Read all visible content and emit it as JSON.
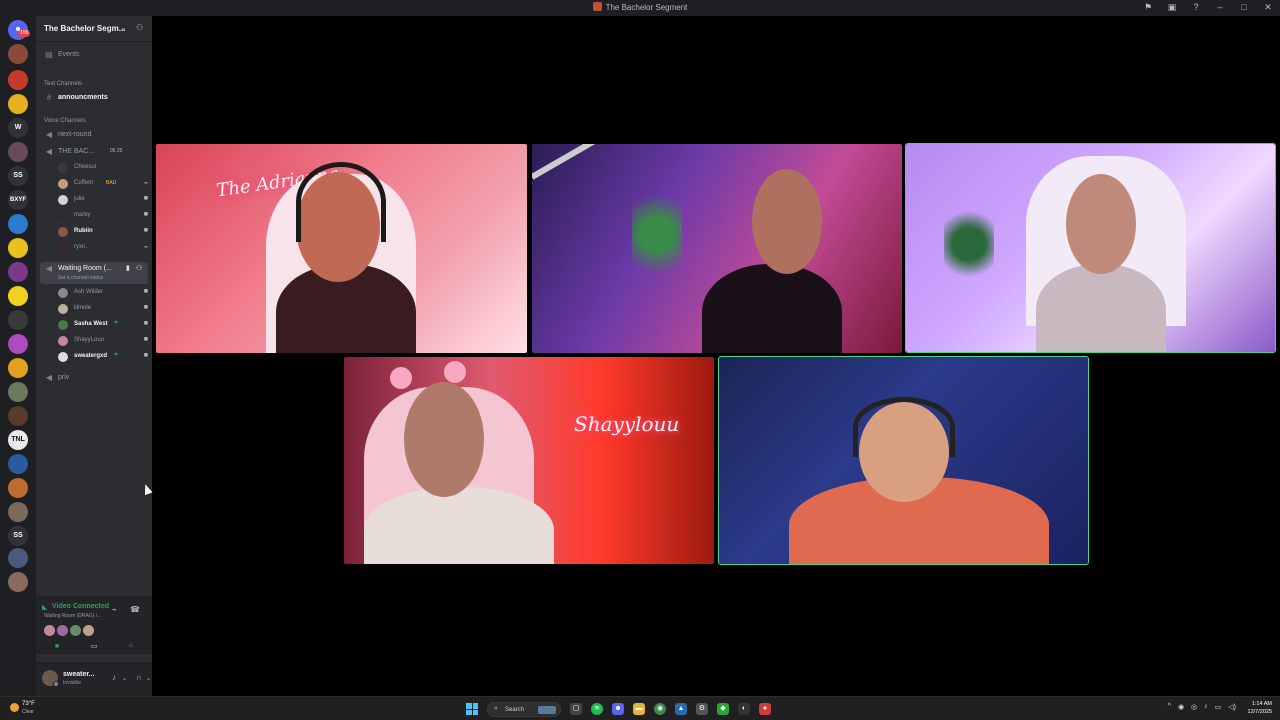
{
  "window": {
    "title": "The Bachelor Segment"
  },
  "rail": {
    "badge": "106",
    "labels": {
      "w": "W",
      "ss1": "SS",
      "bxyf": "BXYF",
      "tnl": "TNL",
      "ss2": "SS"
    }
  },
  "server": {
    "name": "The Bachelor Segm...",
    "events_label": "Events",
    "text_category": "Text Channels",
    "text_channels": [
      "announcments"
    ],
    "voice_category": "Voice Channels",
    "voice_channels": {
      "next_round": "next-round",
      "the_bac": "THE BAC...",
      "the_bac_counts": "06  25",
      "waiting_room": "Waiting Room (...",
      "waiting_status": "Set a channel status",
      "priv": "priv"
    },
    "the_bac_members": [
      "Cheesur",
      "Cuffem",
      "julie",
      "marky",
      "Rubiin",
      "ryxn."
    ],
    "cuffem_tag": "BAU",
    "waiting_members": [
      "Ash Wilder",
      "lilmole",
      "Sasha West",
      "ShayyLouu",
      "sweatergxd"
    ]
  },
  "voice_panel": {
    "title": "Video Connected",
    "subtitle": "Waiting Room (DRAG) /...",
    "camera_button": "camera",
    "screen_button": "screen-share",
    "activity_button": "activities"
  },
  "user_panel": {
    "name": "sweater...",
    "status": "Invisible"
  },
  "video_tiles": {
    "neon_1": "The Adrianna",
    "neon_2": "Shayylouu"
  },
  "taskbar": {
    "temperature": "73°F",
    "condition": "Clear",
    "search_label": "Search",
    "time": "1:14 AM",
    "date": "12/7/2025"
  },
  "colors": {
    "accent_green": "#23a55a",
    "speaking_outline": "#4bd58a",
    "sidebar_bg": "#2b2d31",
    "rail_bg": "#1e1f22"
  }
}
